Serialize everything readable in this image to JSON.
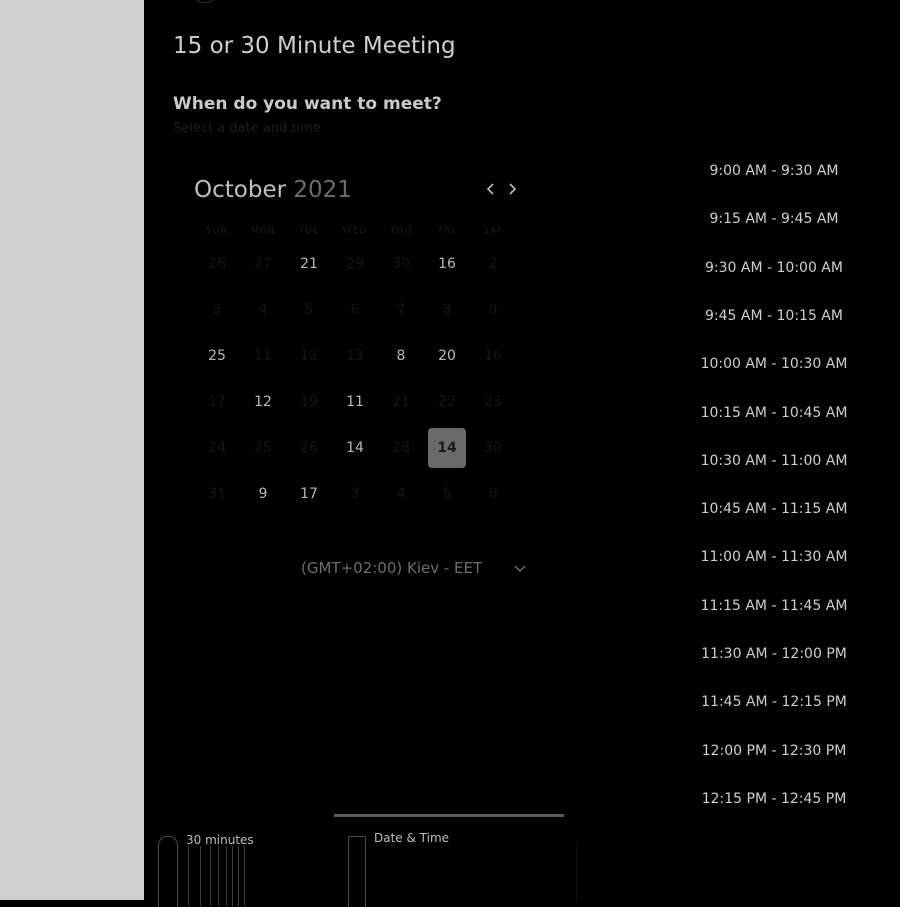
{
  "meeting": {
    "title": "15 or 30 Minute Meeting",
    "question": "When do you want to meet?",
    "helper": "Select a date and time"
  },
  "calendar": {
    "month": "October",
    "year": "2021",
    "prev_icon": "chevron-left-icon",
    "next_icon": "chevron-right-icon",
    "weekdays": [
      "SUN",
      "MON",
      "TUE",
      "WED",
      "THU",
      "FRI",
      "SAT"
    ],
    "days": [
      {
        "label": "26",
        "row": 0,
        "col": 0,
        "available": false
      },
      {
        "label": "27",
        "row": 0,
        "col": 1,
        "available": false
      },
      {
        "label": "21",
        "row": 0,
        "col": 2,
        "available": true
      },
      {
        "label": "29",
        "row": 0,
        "col": 3,
        "available": false
      },
      {
        "label": "30",
        "row": 0,
        "col": 4,
        "available": false
      },
      {
        "label": "16",
        "row": 0,
        "col": 5,
        "available": true
      },
      {
        "label": "2",
        "row": 0,
        "col": 6,
        "available": false
      },
      {
        "label": "3",
        "row": 1,
        "col": 0,
        "available": false
      },
      {
        "label": "4",
        "row": 1,
        "col": 1,
        "available": false
      },
      {
        "label": "5",
        "row": 1,
        "col": 2,
        "available": false
      },
      {
        "label": "6",
        "row": 1,
        "col": 3,
        "available": false
      },
      {
        "label": "7",
        "row": 1,
        "col": 4,
        "available": false
      },
      {
        "label": "8",
        "row": 1,
        "col": 5,
        "available": false
      },
      {
        "label": "9",
        "row": 1,
        "col": 6,
        "available": false
      },
      {
        "label": "25",
        "row": 2,
        "col": 0,
        "available": true
      },
      {
        "label": "11",
        "row": 2,
        "col": 1,
        "available": false
      },
      {
        "label": "12",
        "row": 2,
        "col": 2,
        "available": false
      },
      {
        "label": "13",
        "row": 2,
        "col": 3,
        "available": false
      },
      {
        "label": "8",
        "row": 2,
        "col": 4,
        "available": true
      },
      {
        "label": "20",
        "row": 2,
        "col": 5,
        "available": true
      },
      {
        "label": "16",
        "row": 2,
        "col": 6,
        "available": false
      },
      {
        "label": "17",
        "row": 3,
        "col": 0,
        "available": false
      },
      {
        "label": "12",
        "row": 3,
        "col": 1,
        "available": true
      },
      {
        "label": "19",
        "row": 3,
        "col": 2,
        "available": false
      },
      {
        "label": "11",
        "row": 3,
        "col": 3,
        "available": true
      },
      {
        "label": "21",
        "row": 3,
        "col": 4,
        "available": false
      },
      {
        "label": "22",
        "row": 3,
        "col": 5,
        "available": false
      },
      {
        "label": "23",
        "row": 3,
        "col": 6,
        "available": false
      },
      {
        "label": "24",
        "row": 4,
        "col": 0,
        "available": false
      },
      {
        "label": "25",
        "row": 4,
        "col": 1,
        "available": false
      },
      {
        "label": "26",
        "row": 4,
        "col": 2,
        "available": false
      },
      {
        "label": "14",
        "row": 4,
        "col": 3,
        "available": true
      },
      {
        "label": "28",
        "row": 4,
        "col": 4,
        "available": false
      },
      {
        "label": "14",
        "row": 4,
        "col": 5,
        "available": true,
        "selected": true
      },
      {
        "label": "30",
        "row": 4,
        "col": 6,
        "available": false
      },
      {
        "label": "31",
        "row": 5,
        "col": 0,
        "available": false
      },
      {
        "label": "9",
        "row": 5,
        "col": 1,
        "available": true
      },
      {
        "label": "17",
        "row": 5,
        "col": 2,
        "available": true
      },
      {
        "label": "3",
        "row": 5,
        "col": 3,
        "available": false
      },
      {
        "label": "4",
        "row": 5,
        "col": 4,
        "available": false
      },
      {
        "label": "5",
        "row": 5,
        "col": 5,
        "available": false
      },
      {
        "label": "6",
        "row": 5,
        "col": 6,
        "available": false
      }
    ],
    "timezone": "(GMT+02:00) Kiev - EET",
    "timezone_icon": "chevron-down-icon"
  },
  "time_slots": [
    "9:00 AM - 9:30 AM",
    "9:15 AM - 9:45 AM",
    "9:30 AM - 10:00 AM",
    "9:45 AM - 10:15 AM",
    "10:00 AM - 10:30 AM",
    "10:15 AM - 10:45 AM",
    "10:30 AM - 11:00 AM",
    "10:45 AM - 11:15 AM",
    "11:00 AM - 11:30 AM",
    "11:15 AM - 11:45 AM",
    "11:30 AM - 12:00 PM",
    "11:45 AM - 12:15 PM",
    "12:00 PM - 12:30 PM",
    "12:15 PM - 12:45 PM"
  ],
  "steps": {
    "duration_label": "30 minutes",
    "date_label": "Date & Time"
  }
}
